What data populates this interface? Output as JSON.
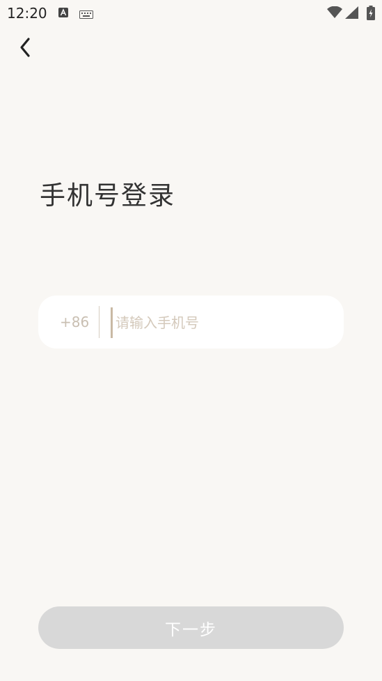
{
  "status_bar": {
    "time": "12:20"
  },
  "header": {
    "title": "手机号登录"
  },
  "phone_form": {
    "country_code": "+86",
    "phone_value": "",
    "phone_placeholder": "请输入手机号"
  },
  "footer": {
    "next_label": "下一步"
  },
  "colors": {
    "background": "#f9f7f4",
    "card": "#ffffff",
    "accent": "#c9b9a4",
    "button_disabled": "#d8d8d8"
  }
}
